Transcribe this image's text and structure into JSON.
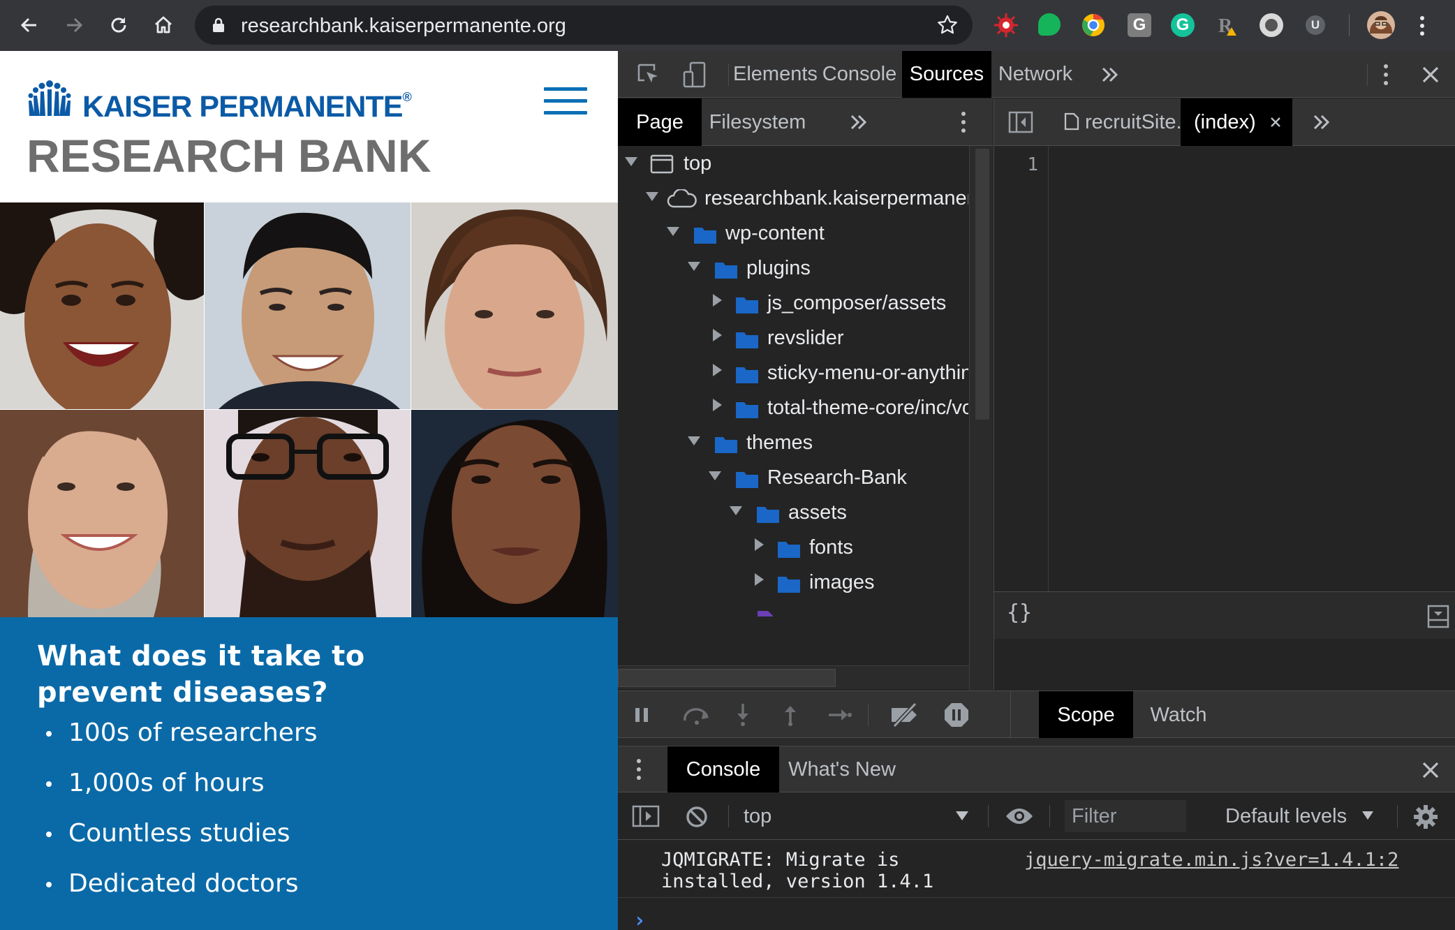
{
  "browser": {
    "url": "researchbank.kaiserpermanente.org"
  },
  "webpage": {
    "brand": "KAISER PERMANENTE",
    "brand_mark": "®",
    "title": "RESEARCH BANK",
    "question": "What does it take to prevent diseases?",
    "facts": [
      "100s of researchers",
      "1,000s of hours",
      "Countless studies",
      "Dedicated doctors"
    ],
    "colors": {
      "brand_blue": "#0b5aa6",
      "panel_blue": "#0a6aa8",
      "title_gray": "#6e6e6e"
    }
  },
  "devtools": {
    "main_tabs": [
      "Elements",
      "Console",
      "Sources",
      "Network"
    ],
    "active_main_tab": "Sources",
    "navigator_tabs": [
      "Page",
      "Filesystem"
    ],
    "active_navigator_tab": "Page",
    "tree": [
      {
        "label": "top",
        "depth": 0,
        "kind": "frame",
        "expanded": true
      },
      {
        "label": "researchbank.kaiserpermanente.org",
        "depth": 1,
        "kind": "cloud",
        "expanded": true
      },
      {
        "label": "wp-content",
        "depth": 2,
        "kind": "folder",
        "expanded": true
      },
      {
        "label": "plugins",
        "depth": 3,
        "kind": "folder",
        "expanded": true
      },
      {
        "label": "js_composer/assets",
        "depth": 4,
        "kind": "folder",
        "expanded": false
      },
      {
        "label": "revslider",
        "depth": 4,
        "kind": "folder",
        "expanded": false
      },
      {
        "label": "sticky-menu-or-anything-on-scroll",
        "depth": 4,
        "kind": "folder",
        "expanded": false
      },
      {
        "label": "total-theme-core/inc/vcex",
        "depth": 4,
        "kind": "folder",
        "expanded": false
      },
      {
        "label": "themes",
        "depth": 3,
        "kind": "folder",
        "expanded": true
      },
      {
        "label": "Research-Bank",
        "depth": 4,
        "kind": "folder",
        "expanded": true
      },
      {
        "label": "assets",
        "depth": 5,
        "kind": "folder",
        "expanded": true
      },
      {
        "label": "fonts",
        "depth": 6,
        "kind": "folder",
        "expanded": false
      },
      {
        "label": "images",
        "depth": 6,
        "kind": "folder",
        "expanded": false
      }
    ],
    "editor_tabs": [
      {
        "label": "recruitSite.js",
        "active": false
      },
      {
        "label": "(index)",
        "active": true
      }
    ],
    "line_number": "1",
    "pretty_print": "{}",
    "sidebar_tabs": [
      "Scope",
      "Watch"
    ],
    "active_sidebar_tab": "Scope",
    "drawer_tabs": [
      "Console",
      "What's New"
    ],
    "active_drawer_tab": "Console",
    "console_context": "top",
    "filter_placeholder": "Filter",
    "levels": "Default levels",
    "console_message": "JQMIGRATE: Migrate is installed, version 1.4.1",
    "console_source": "jquery-migrate.min.js?ver=1.4.1:2",
    "prompt": "›",
    "colors": {
      "panel_bg": "#242424",
      "toolbar_bg": "#333333",
      "active_tab_bg": "#000000",
      "folder_blue": "#1a67c7",
      "prompt_blue": "#4d8df7"
    }
  }
}
